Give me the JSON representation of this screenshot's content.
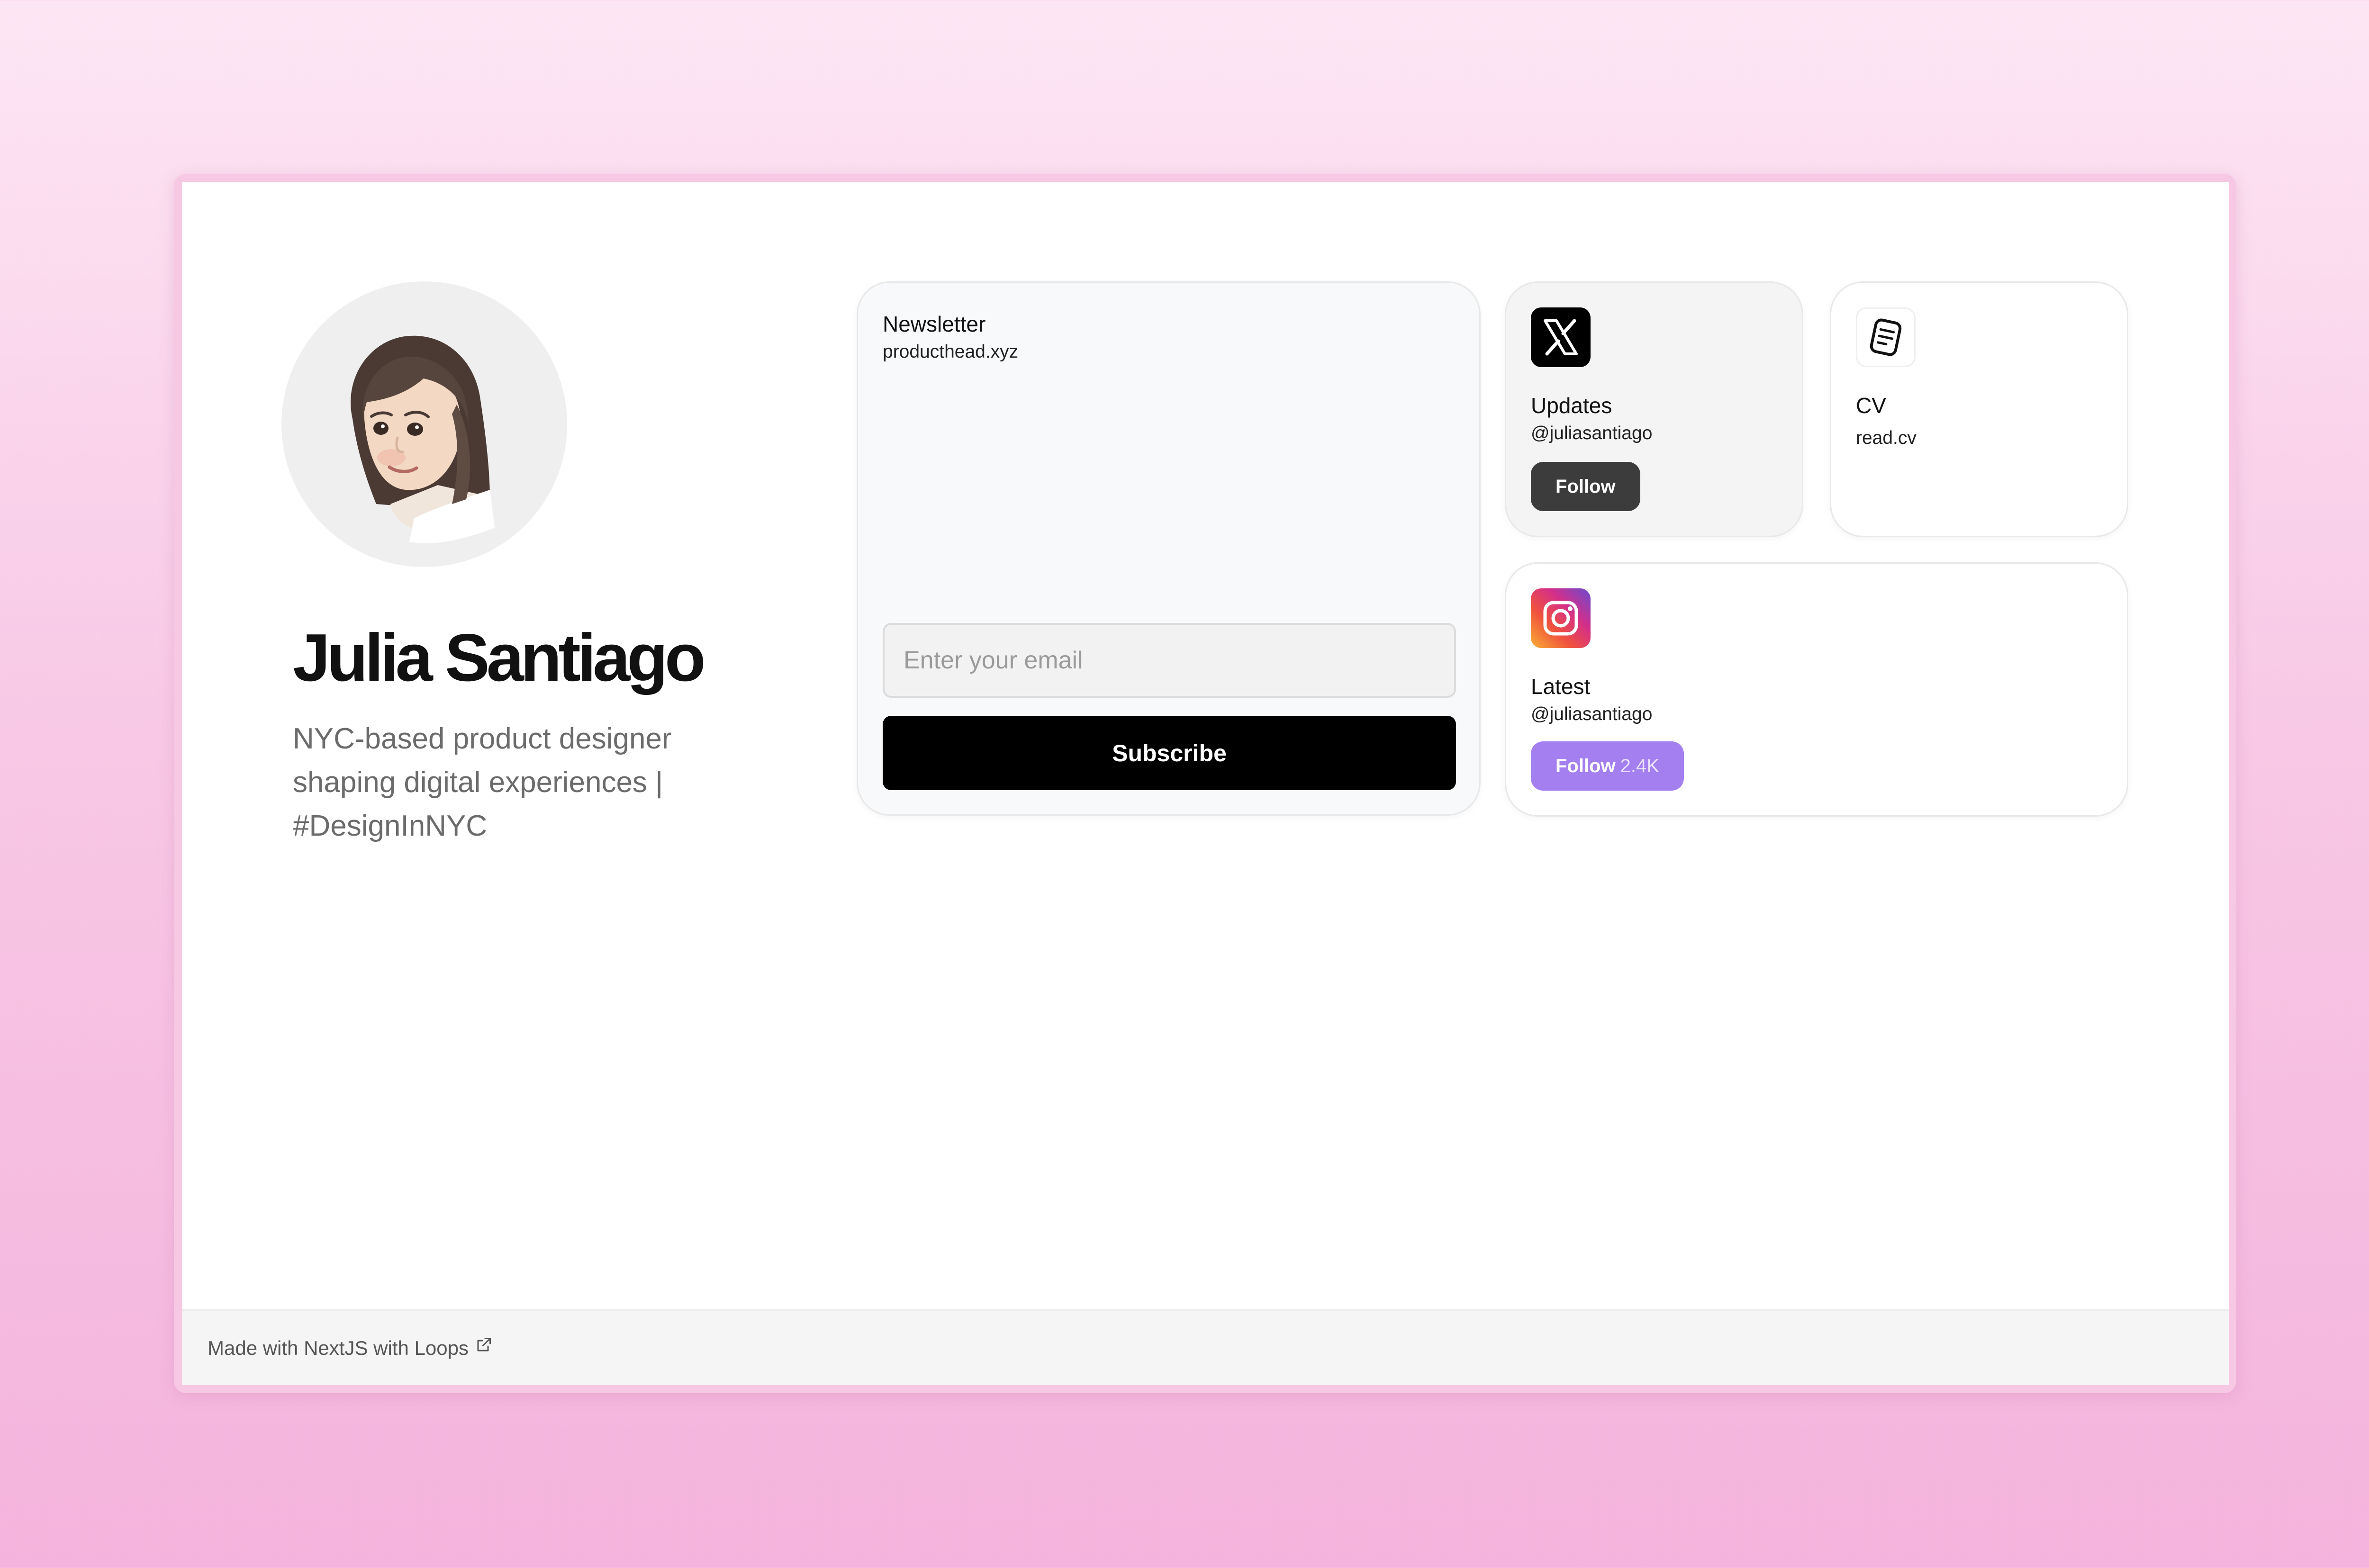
{
  "profile": {
    "name": "Julia Santiago",
    "bio": "NYC-based product designer shaping digital experiences | #DesignInNYC"
  },
  "newsletter": {
    "title": "Newsletter",
    "subtitle": "producthead.xyz",
    "email_placeholder": "Enter your email",
    "email_value": "",
    "subscribe_label": "Subscribe"
  },
  "x_card": {
    "icon": "x-logo-icon",
    "title": "Updates",
    "handle": "@juliasantiago",
    "follow_label": "Follow"
  },
  "cv_card": {
    "icon": "document-icon",
    "title": "CV",
    "subtitle": "read.cv"
  },
  "instagram_card": {
    "icon": "instagram-icon",
    "title": "Latest",
    "handle": "@juliasantiago",
    "follow_label": "Follow",
    "follow_count": "2.4K"
  },
  "footer": {
    "text": "Made with NextJS with Loops",
    "icon": "external-link-icon"
  },
  "colors": {
    "accent_purple": "#a47ff0",
    "dark_button": "#3c3c3c",
    "subscribe_button": "#000000",
    "background_pink": "#f8c9e6"
  }
}
